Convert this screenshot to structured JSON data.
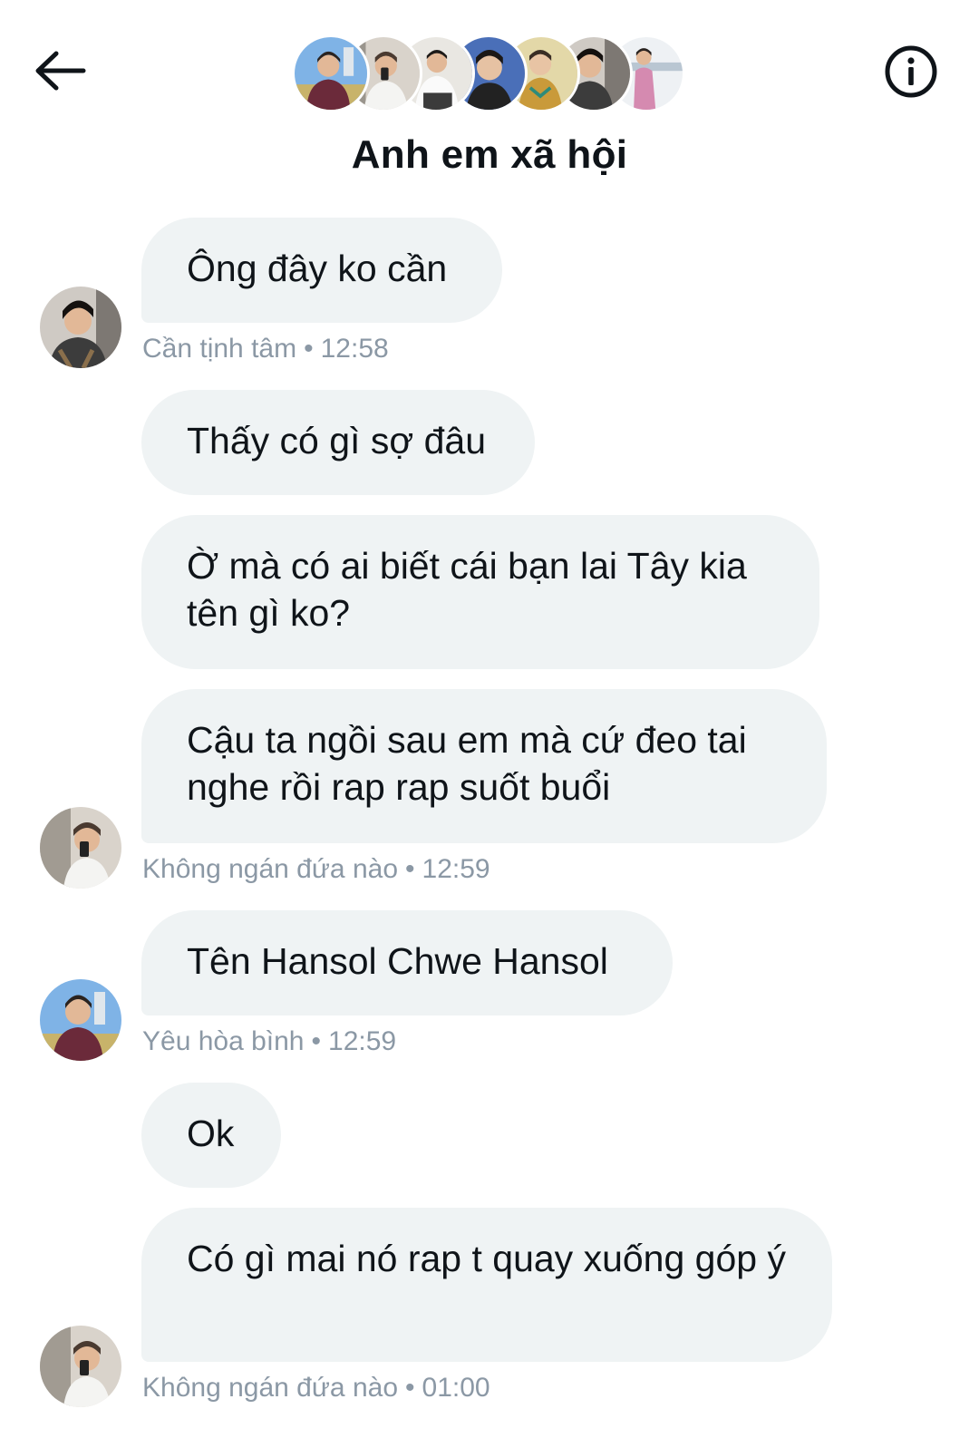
{
  "header": {
    "back_icon": "arrow-left-icon",
    "info_icon": "info-circle-icon",
    "title": "Anh em xã hội",
    "member_count": 7
  },
  "messages": [
    {
      "text": "Ông đây ko cần"
    },
    {
      "text": "Thấy có gì sợ đâu"
    },
    {
      "text": "Ờ mà có ai biết cái bạn lai Tây kia tên gì ko?"
    },
    {
      "text": "Cậu ta ngồi sau em mà cứ đeo tai nghe rồi rap rap suốt buổi"
    },
    {
      "text": "Tên Hansol Chwe Hansol"
    },
    {
      "text": "Ok"
    },
    {
      "text": "Có gì mai nó rap t quay xuống góp ý"
    }
  ],
  "groups": [
    {
      "sender": "Cần tịnh tâm",
      "separator": "•",
      "time": "12:58"
    },
    {
      "sender": "Không ngán đứa nào",
      "separator": "•",
      "time": "12:59"
    },
    {
      "sender": "Yêu hòa bình",
      "separator": "•",
      "time": "12:59"
    },
    {
      "sender": "Không ngán đứa nào",
      "separator": "•",
      "time": "01:00"
    }
  ],
  "colors": {
    "bubble_bg": "#eff3f4",
    "text": "#0f1419",
    "meta_text": "#8b98a5",
    "background": "#ffffff"
  }
}
